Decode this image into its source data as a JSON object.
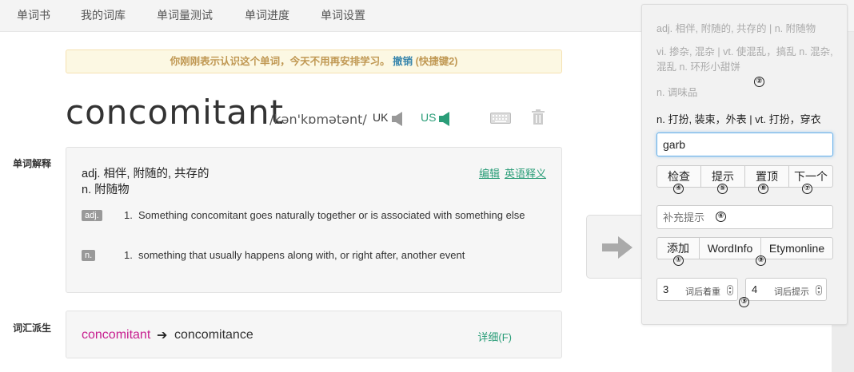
{
  "nav": {
    "items": [
      "单词书",
      "我的词库",
      "单词量测试",
      "单词进度",
      "单词设置"
    ]
  },
  "notice": {
    "text": "你刚刚表示认识这个单词，今天不用再安排学习。",
    "undo": "撤销",
    "shortcut": "(快捷键2)"
  },
  "word": {
    "text": "concomitant",
    "phonetic": "/kən'kɒmətənt/",
    "uk_label": "UK",
    "us_label": "US"
  },
  "labels": {
    "definition": "单词解释",
    "derivatives": "词汇派生"
  },
  "definition": {
    "cn_line1": "adj. 相伴, 附随的, 共存的",
    "cn_line2": "n. 附随物",
    "edit": "编辑",
    "english_def": "英语释义",
    "senses": [
      {
        "pos": "adj.",
        "num": "1.",
        "text": "Something concomitant goes naturally together or is associated with something else"
      },
      {
        "pos": "n.",
        "num": "1.",
        "text": "something that usually happens along with, or right after, another event"
      }
    ]
  },
  "derivatives": {
    "from": "concomitant",
    "arrow": "➔",
    "to": "concomitance",
    "detail": "详细(F)"
  },
  "panel": {
    "hint1": "adj. 相伴, 附随的, 共存的 | n. 附随物",
    "hint2": "vi. 掺杂, 混杂 | vt. 使混乱，搞乱 n. 混杂, 混乱 n. 环形小甜饼",
    "hint3": "n. 调味品",
    "current_meaning": "n. 打扮, 装束，外表 | vt. 打扮，穿衣",
    "answer_value": "garb",
    "buttons_row1": [
      "检查",
      "提示",
      "置顶",
      "下一个"
    ],
    "hint_placeholder": "补充提示",
    "buttons_row2": [
      "添加",
      "WordInfo",
      "Etymonline"
    ],
    "stepper1": {
      "value": "3",
      "label": "词后着重"
    },
    "stepper2": {
      "value": "4",
      "label": "词后提示"
    },
    "markers": [
      "①",
      "②",
      "③",
      "④",
      "⑤",
      "⑥",
      "⑦",
      "⑧",
      "⑨"
    ]
  },
  "colors": {
    "accent_green": "#2a9d78",
    "notice_text": "#c09853",
    "link_blue": "#3a87ad",
    "derivative_pink": "#c71f8f"
  }
}
